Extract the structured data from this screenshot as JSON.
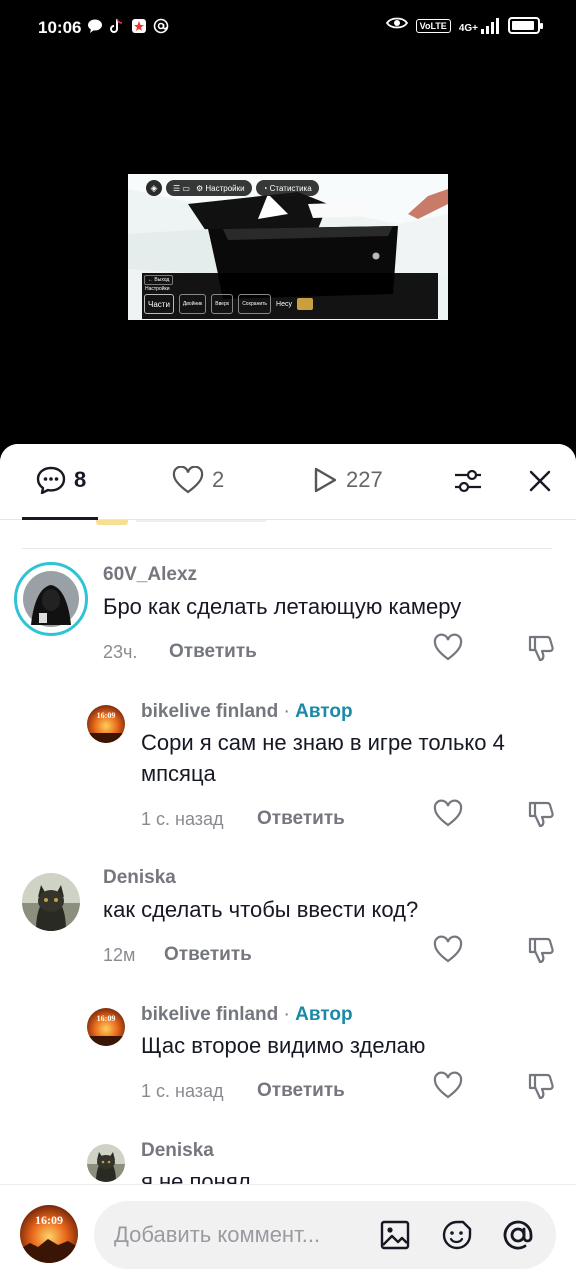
{
  "status_bar": {
    "time": "10:06",
    "volte": "VoLTE",
    "network": "4G+",
    "battery_level": 0.9,
    "icons": [
      "messenger-icon",
      "tiktok-icon",
      "app-icon",
      "at-icon",
      "eye-icon",
      "signal-icon",
      "battery-icon"
    ]
  },
  "video": {
    "top_pills": [
      "Настройки",
      "Статистика"
    ],
    "back_label": "Выход",
    "settings_label": "Настройки",
    "buttons": [
      "Части",
      "Двойник",
      "Вверх",
      "Сохранить"
    ],
    "extra_label": "Несу"
  },
  "tabs": {
    "comments_count": "8",
    "likes_count": "2",
    "views_count": "227"
  },
  "comments": [
    {
      "username": "60V_Alexz",
      "text": "Бро как сделать летающую камеру",
      "time": "23ч.",
      "reply_label": "Ответить",
      "author": ""
    },
    {
      "username": "bikelive finland",
      "author": "Автор",
      "text": "Сори я сам не знаю в игре только 4 мпсяца",
      "time": "1 с. назад",
      "reply_label": "Ответить"
    },
    {
      "username": "Deniska",
      "text": "как сделать чтобы ввести код?",
      "time": "12м",
      "reply_label": "Ответить",
      "author": ""
    },
    {
      "username": "bikelive finland",
      "author": "Автор",
      "text": "Щас второе видимо зделаю",
      "time": "1 с. назад",
      "reply_label": "Ответить"
    },
    {
      "username": "Deniska",
      "text": "я не понял",
      "author": ""
    }
  ],
  "composer": {
    "placeholder": "Добавить коммент...",
    "avatar_text": "16:09"
  },
  "colors": {
    "author": "#1a8aa8",
    "story_ring": "#2ec4d6"
  }
}
